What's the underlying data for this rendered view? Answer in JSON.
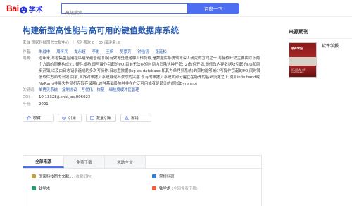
{
  "header": {
    "logo_text_bai": "Bai",
    "logo_text_xs": "学术",
    "search_placeholder": "高级搜索",
    "search_button": "百度一下"
  },
  "paper": {
    "title": "构建新型高性能与高可用的键值数据库系统",
    "source": "来自 国家科技图书文献中心",
    "like_label": "喜欢 0",
    "read_label": "阅读量: 8",
    "authors_label": "作者:",
    "authors": [
      "朱战申",
      "周怀兵",
      "龙永超",
      "李彬",
      "王帆",
      "吴豪亮",
      "钟浩初",
      "张延松"
    ],
    "abstract_label": "摘要:",
    "abstract": "近年来,写密集型应用程序越来越普遍,如何有效地处理这种工作负载,是数据库系统领域深入研究的方向之一.写操作开销主要由以下两个方面的因素构成:(1)硬件成熟,即写操作引起的I/O,目前无法在短时间内消除这种开销;(2)软件开销,即修改内存数据块引起的I/O和同步开销,以及由日志记录造成的多次写操作.日志型数据(log-as-database,即其为单拷贝系统)的架构能够减少写操作引起的I/O,同时降低软件方面的开销.目前,业界对单拷贝系统展现出浓厚的兴趣.现有的单拷贝系统大部分建立在特殊的基础设施之上,例如infiniband或NVRam(非易失性随机存取存储器),这种基础设施并非在广泛可用或者是昂贵的(例如Dynamo)",
    "abstract_more": "展开",
    "keywords_label": "关键词:",
    "keywords": [
      "单拷贝系统",
      "复制协议",
      "写优化",
      "恢复",
      "细粒度缓冲区管理"
    ],
    "doi_label": "DOI:",
    "doi": "10.13328/j.cnki.jos.006023",
    "year_label": "年份:",
    "year": "2021"
  },
  "actions": {
    "favorite": "收藏",
    "cite": "引用",
    "batch_cite": "批量引用",
    "report": "报错"
  },
  "download_panel": {
    "tabs": [
      "全部来源",
      "免费下载",
      "求助全文"
    ],
    "items": [
      {
        "name": "国家科技图书文献...",
        "note": "(收藏机构)"
      },
      {
        "name": "掌桥科研",
        "note": ""
      },
      {
        "name": "钛学术",
        "note": ""
      },
      {
        "name": "钛学术",
        "note": "(全网免费下载)"
      }
    ]
  },
  "sidebar": {
    "title": "来源期刊",
    "journal_name": "软件学报",
    "cover_title": "软件学报",
    "cover_footer": "JOURNAL OF SOFTWARE"
  },
  "colors": {
    "brand_blue": "#4e6ef2",
    "link_blue": "#2a5db0",
    "logo_red": "#e10601"
  }
}
